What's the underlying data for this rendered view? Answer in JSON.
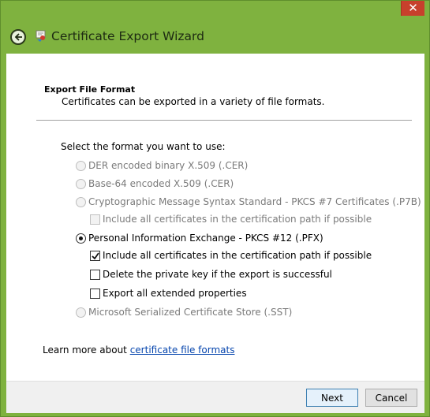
{
  "window": {
    "title": "Certificate Export Wizard",
    "close_glyph": "✕",
    "accent_color": "#7fb23f",
    "back_icon": "back-arrow-icon",
    "app_icon": "certificate-icon"
  },
  "section": {
    "title": "Export File Format",
    "subtitle": "Certificates can be exported in a variety of file formats."
  },
  "prompt": "Select the format you want to use:",
  "formats": [
    {
      "label": "DER encoded binary X.509 (.CER)",
      "selected": false,
      "enabled": false
    },
    {
      "label": "Base-64 encoded X.509 (.CER)",
      "selected": false,
      "enabled": false
    },
    {
      "label": "Cryptographic Message Syntax Standard - PKCS #7 Certificates (.P7B)",
      "selected": false,
      "enabled": false
    },
    {
      "label": "Personal Information Exchange - PKCS #12 (.PFX)",
      "selected": true,
      "enabled": true
    },
    {
      "label": "Microsoft Serialized Certificate Store (.SST)",
      "selected": false,
      "enabled": false
    }
  ],
  "p7b_options": [
    {
      "label": "Include all certificates in the certification path if possible",
      "checked": false,
      "enabled": false
    }
  ],
  "pfx_options": [
    {
      "label": "Include all certificates in the certification path if possible",
      "checked": true,
      "enabled": true
    },
    {
      "label": "Delete the private key if the export is successful",
      "checked": false,
      "enabled": true
    },
    {
      "label": "Export all extended properties",
      "checked": false,
      "enabled": true
    }
  ],
  "learn_more": {
    "text": "Learn more about ",
    "link": "certificate file formats"
  },
  "buttons": {
    "next": "Next",
    "cancel": "Cancel"
  }
}
